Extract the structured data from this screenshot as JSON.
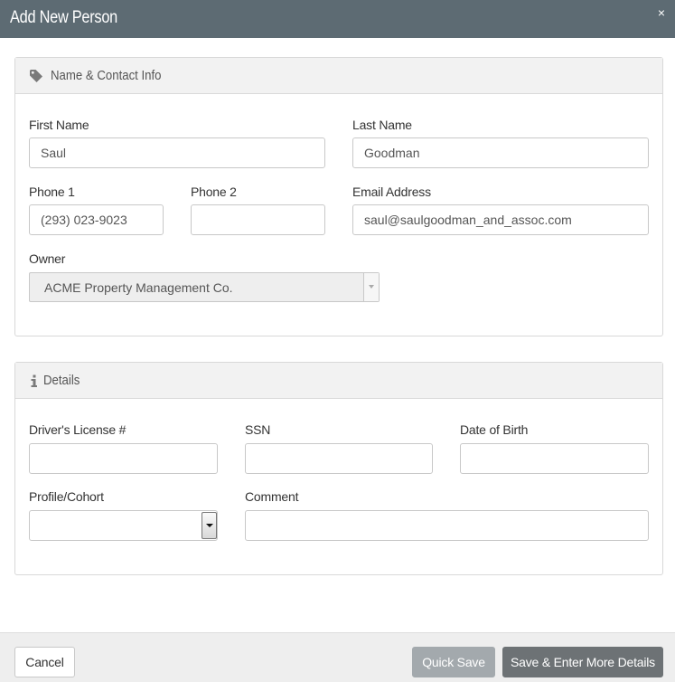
{
  "dialog": {
    "title": "Add New Person",
    "close_label": "×"
  },
  "sections": {
    "contact": {
      "title": "Name & Contact Info",
      "icon": "tag-icon",
      "first_name": {
        "label": "First Name",
        "value": "Saul"
      },
      "last_name": {
        "label": "Last Name",
        "value": "Goodman"
      },
      "phone1": {
        "label": "Phone 1",
        "value": "(293) 023-9023"
      },
      "phone2": {
        "label": "Phone 2",
        "value": ""
      },
      "email": {
        "label": "Email Address",
        "value": "saul@saulgoodman_and_assoc.com"
      },
      "owner": {
        "label": "Owner",
        "value": "ACME Property Management Co."
      }
    },
    "details": {
      "title": "Details",
      "icon": "info-icon",
      "license": {
        "label": "Driver's License #",
        "value": ""
      },
      "ssn": {
        "label": "SSN",
        "value": ""
      },
      "dob": {
        "label": "Date of Birth",
        "value": ""
      },
      "profile": {
        "label": "Profile/Cohort",
        "value": ""
      },
      "comment": {
        "label": "Comment",
        "value": ""
      }
    }
  },
  "footer": {
    "cancel_label": "Cancel",
    "quick_save_label": "Quick Save",
    "save_more_label": "Save & Enter More Details"
  },
  "colors": {
    "header_bg": "#5d6b73",
    "quick_save_bg": "#a3a9ad",
    "save_more_bg": "#6d7275"
  }
}
